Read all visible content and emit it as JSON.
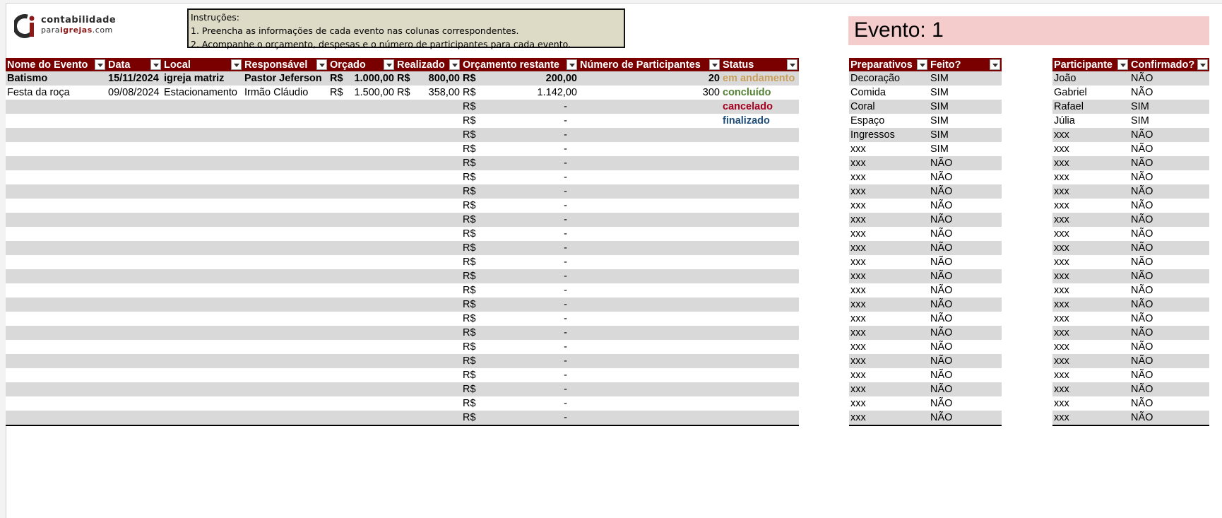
{
  "logo": {
    "line1": "contabilidade",
    "line2_pre": "para",
    "line2_bold": "igrejas",
    "line2_post": ".com"
  },
  "instructions": {
    "title": "Instruções:",
    "line1": "1. Preencha as informações de cada evento nas colunas correspondentes.",
    "line2": "2. Acompanhe o orçamento, despesas e o número de participantes para cada evento."
  },
  "evento_label": "Evento: 1",
  "events_table": {
    "headers": [
      "Nome do Evento",
      "Data",
      "Local",
      "Responsável",
      "Orçado",
      "Realizado",
      "Orçamento restante",
      "Número de Participantes",
      "Status"
    ],
    "currency": "R$",
    "empty_value": "-",
    "rows": [
      {
        "nome": "Batismo",
        "data": "15/11/2024",
        "local": "igreja matriz",
        "responsavel": "Pastor Jeferson",
        "orcado": "1.000,00",
        "realizado": "800,00",
        "restante": "200,00",
        "participantes": "20",
        "status": "em andamento",
        "status_key": "andamento",
        "bold": true
      },
      {
        "nome": "Festa da roça",
        "data": "09/08/2024",
        "local": "Estacionamento",
        "responsavel": "Irmão Cláudio",
        "orcado": "1.500,00",
        "realizado": "358,00",
        "restante": "1.142,00",
        "participantes": "300",
        "status": "concluído",
        "status_key": "concluido",
        "bold": false
      },
      {
        "status": "cancelado",
        "status_key": "cancelado"
      },
      {
        "status": "finalizado",
        "status_key": "finalizado"
      },
      {},
      {},
      {},
      {},
      {},
      {},
      {},
      {},
      {},
      {},
      {},
      {},
      {},
      {},
      {},
      {},
      {},
      {},
      {},
      {},
      {}
    ]
  },
  "prep_table": {
    "headers": [
      "Preparativos",
      "Feito?"
    ],
    "rows": [
      [
        "Decoração",
        "SIM"
      ],
      [
        "Comida",
        "SIM"
      ],
      [
        "Coral",
        "SIM"
      ],
      [
        "Espaço",
        "SIM"
      ],
      [
        "Ingressos",
        "SIM"
      ],
      [
        "xxx",
        "SIM"
      ],
      [
        "xxx",
        "NÃO"
      ],
      [
        "xxx",
        "NÃO"
      ],
      [
        "xxx",
        "NÃO"
      ],
      [
        "xxx",
        "NÃO"
      ],
      [
        "xxx",
        "NÃO"
      ],
      [
        "xxx",
        "NÃO"
      ],
      [
        "xxx",
        "NÃO"
      ],
      [
        "xxx",
        "NÃO"
      ],
      [
        "xxx",
        "NÃO"
      ],
      [
        "xxx",
        "NÃO"
      ],
      [
        "xxx",
        "NÃO"
      ],
      [
        "xxx",
        "NÃO"
      ],
      [
        "xxx",
        "NÃO"
      ],
      [
        "xxx",
        "NÃO"
      ],
      [
        "xxx",
        "NÃO"
      ],
      [
        "xxx",
        "NÃO"
      ],
      [
        "xxx",
        "NÃO"
      ],
      [
        "xxx",
        "NÃO"
      ],
      [
        "xxx",
        "NÃO"
      ]
    ]
  },
  "part_table": {
    "headers": [
      "Participante",
      "Confirmado?"
    ],
    "rows": [
      [
        "João",
        "NÃO"
      ],
      [
        "Gabriel",
        "NÃO"
      ],
      [
        "Rafael",
        "SIM"
      ],
      [
        "Júlia",
        "SIM"
      ],
      [
        "xxx",
        "NÃO"
      ],
      [
        "xxx",
        "NÃO"
      ],
      [
        "xxx",
        "NÃO"
      ],
      [
        "xxx",
        "NÃO"
      ],
      [
        "xxx",
        "NÃO"
      ],
      [
        "xxx",
        "NÃO"
      ],
      [
        "xxx",
        "NÃO"
      ],
      [
        "xxx",
        "NÃO"
      ],
      [
        "xxx",
        "NÃO"
      ],
      [
        "xxx",
        "NÃO"
      ],
      [
        "xxx",
        "NÃO"
      ],
      [
        "xxx",
        "NÃO"
      ],
      [
        "xxx",
        "NÃO"
      ],
      [
        "xxx",
        "NÃO"
      ],
      [
        "xxx",
        "NÃO"
      ],
      [
        "xxx",
        "NÃO"
      ],
      [
        "xxx",
        "NÃO"
      ],
      [
        "xxx",
        "NÃO"
      ],
      [
        "xxx",
        "NÃO"
      ],
      [
        "xxx",
        "NÃO"
      ],
      [
        "xxx",
        "NÃO"
      ]
    ]
  }
}
